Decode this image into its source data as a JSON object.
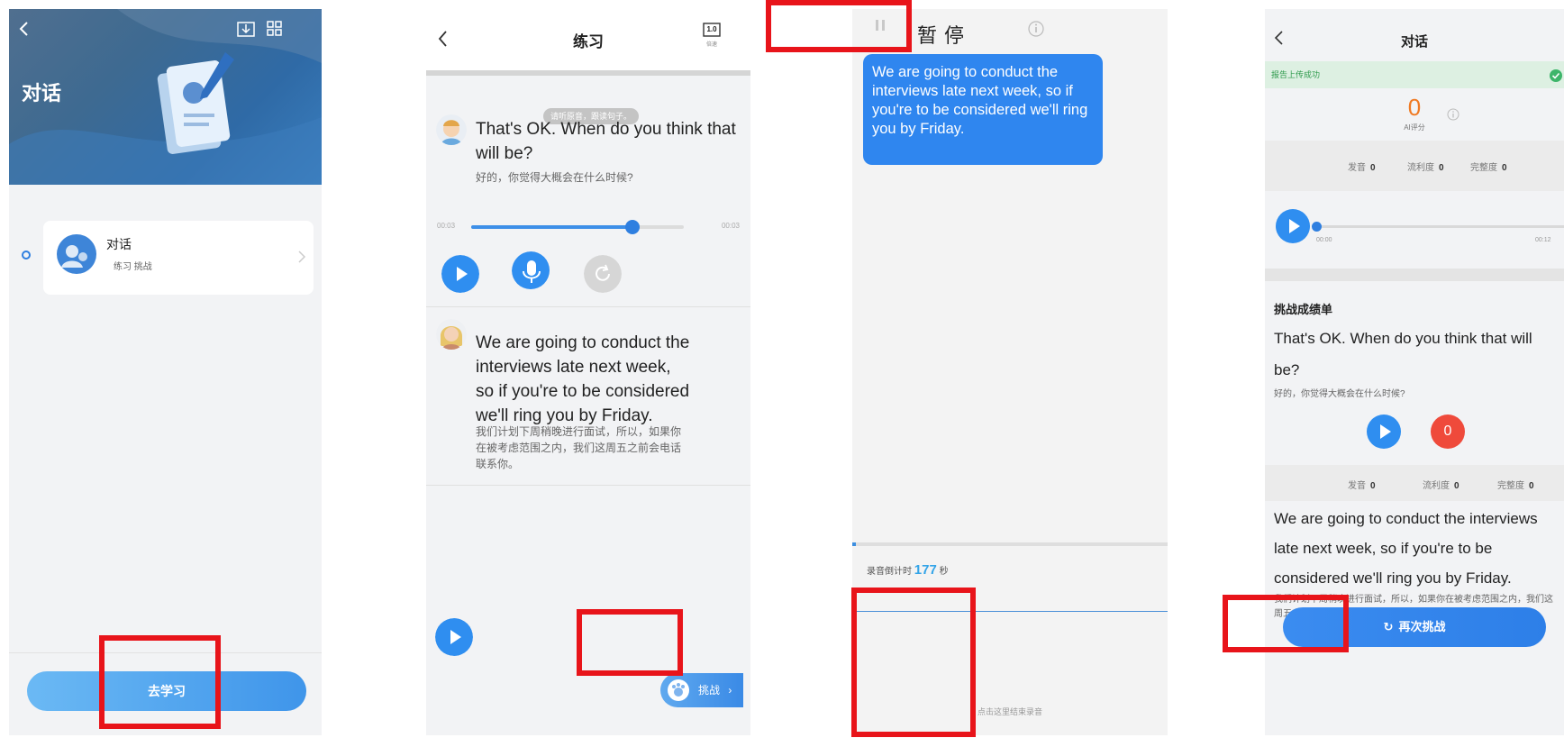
{
  "screen1": {
    "title": "对话",
    "card_title": "对话",
    "card_subtitle": "练习 挑战",
    "cta_label": "去学习"
  },
  "screen2": {
    "title": "练习",
    "speed_label": "倍速",
    "speed_value": "1.0",
    "tip": "请听原音，跟读句子。",
    "sentence1_en": "That's OK. When do you think that will be?",
    "sentence1_cn": "好的，你觉得大概会在什么时候?",
    "time_start": "00:03",
    "time_end": "00:03",
    "progress": 0.76,
    "sentence2_en": "We are going to conduct the interviews late next week, so if you're to be considered we'll ring you by Friday.",
    "sentence2_cn": "我们计划下周稍晚进行面试，所以，如果你在被考虑范围之内，我们这周五之前会电话联系你。",
    "challenge_label": "挑战"
  },
  "screen3": {
    "pause_label": "暂停",
    "bubble_text": "We are going to conduct the interviews late next week, so if you're to be considered we'll ring you by Friday.",
    "countdown_prefix": "录音倒计时",
    "countdown_value": "177",
    "countdown_unit": "秒",
    "end_hint": "点击这里结束录音"
  },
  "screen4": {
    "title": "对话",
    "upload_status": "报告上传成功",
    "score": "0",
    "score_label": "AI评分",
    "metrics": [
      {
        "label": "发音",
        "value": "0"
      },
      {
        "label": "流利度",
        "value": "0"
      },
      {
        "label": "完整度",
        "value": "0"
      }
    ],
    "time_start": "00:00",
    "time_end": "00:12",
    "report_heading": "挑战成绩单",
    "s1_en_line1": "That's OK. When do you think that will",
    "s1_en_line2": "be?",
    "s1_cn": "好的，你觉得大概会在什么时候?",
    "s1_score": "0",
    "s2_en_line1": "We are going to conduct the interviews",
    "s2_en_line2": "late next week, so if you're to be",
    "s2_en_line3": "considered we'll ring you by Friday.",
    "s2_cn": "我们计划下周稍晚进行面试，所以，如果你在被考虑范围之内，我们这周五之前会电话联系你。",
    "retry_label": "再次挑战"
  },
  "colors": {
    "primary_blue": "#2f86ef",
    "highlight_red": "#e8141a",
    "score_orange": "#f07a23",
    "success_green": "#2e9a4c"
  }
}
